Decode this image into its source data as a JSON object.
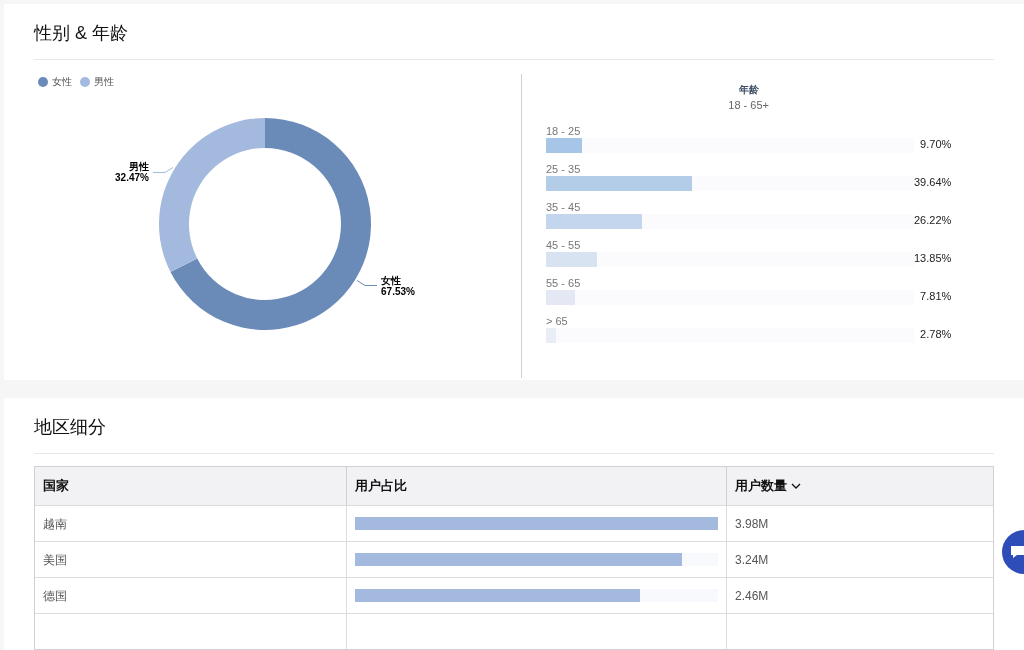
{
  "gender_age": {
    "title": "性别 & 年龄",
    "legend": [
      {
        "label": "女性",
        "color": "#6a8bb8"
      },
      {
        "label": "男性",
        "color": "#a3bade"
      }
    ],
    "chart_data": {
      "type": "donut",
      "categories": [
        "女性",
        "男性"
      ],
      "values": [
        67.53,
        32.47
      ],
      "value_labels": [
        "67.53%",
        "32.47%"
      ]
    },
    "age": {
      "title": "年龄",
      "subtitle": "18 - 65+",
      "groups": [
        {
          "label": "18 - 25",
          "level": 0.097,
          "reading": "9.70%",
          "color": "#a7c5e6"
        },
        {
          "label": "25 - 35",
          "level": 0.3964,
          "reading": "39.64%",
          "color": "#b3cde9"
        },
        {
          "label": "35 - 45",
          "level": 0.2622,
          "reading": "26.22%",
          "color": "#c3d6ee"
        },
        {
          "label": "45 - 55",
          "level": 0.1385,
          "reading": "13.85%",
          "color": "#d8e3f2"
        },
        {
          "label": "55 - 65",
          "level": 0.0781,
          "reading": "7.81%",
          "color": "#e3e8f4"
        },
        {
          "label": "> 65",
          "level": 0.0278,
          "reading": "2.78%",
          "color": "#e9edf6"
        }
      ]
    }
  },
  "regions": {
    "title": "地区细分",
    "table": {
      "columns": [
        {
          "label": "国家",
          "sortable": false
        },
        {
          "label": "用户占比",
          "sortable": false
        },
        {
          "label": "用户数量",
          "sortable": true
        }
      ],
      "rows": [
        {
          "country": "越南",
          "level": 1.0,
          "users": "3.98M"
        },
        {
          "country": "美国",
          "level": 0.9,
          "users": "3.24M"
        },
        {
          "country": "德国",
          "level": 0.785,
          "users": "2.46M"
        }
      ]
    }
  }
}
